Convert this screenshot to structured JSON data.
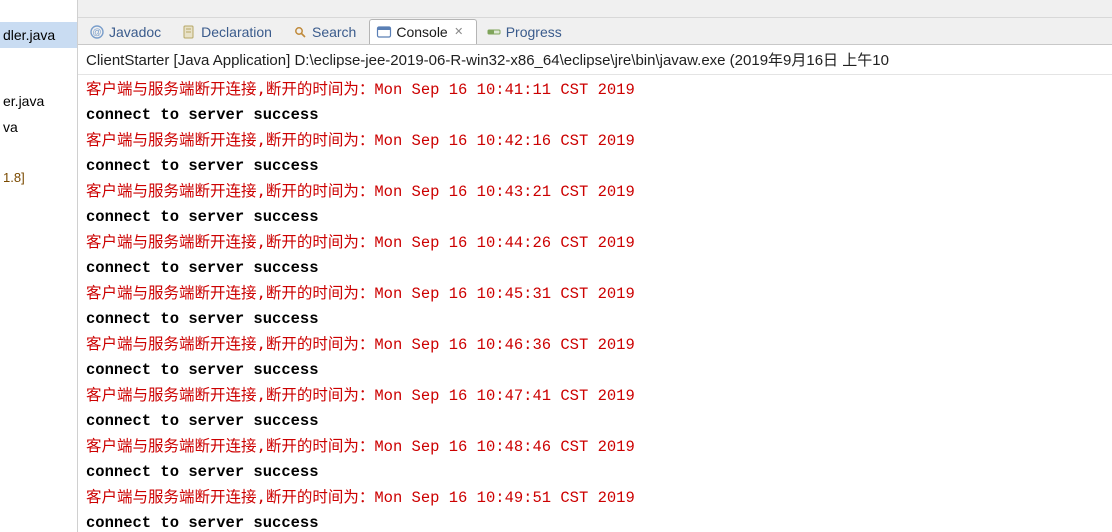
{
  "left_panel": {
    "files": [
      {
        "label": "dler.java",
        "selected": true
      },
      {
        "label": ""
      },
      {
        "label": "er.java"
      },
      {
        "label": "va"
      },
      {
        "label": ""
      },
      {
        "label": "1.8]"
      }
    ]
  },
  "tabs": [
    {
      "id": "javadoc",
      "label": "Javadoc",
      "icon": "at-icon",
      "active": false
    },
    {
      "id": "declaration",
      "label": "Declaration",
      "icon": "file-icon",
      "active": false
    },
    {
      "id": "search",
      "label": "Search",
      "icon": "search-icon",
      "active": false
    },
    {
      "id": "console",
      "label": "Console",
      "icon": "console-icon",
      "active": true
    },
    {
      "id": "progress",
      "label": "Progress",
      "icon": "progress-icon",
      "active": false
    }
  ],
  "close_x": "✕",
  "console": {
    "header": "ClientStarter [Java Application] D:\\eclipse-jee-2019-06-R-win32-x86_64\\eclipse\\jre\\bin\\javaw.exe (2019年9月16日 上午10",
    "err_prefix": "客户端与服务端断开连接,断开的时间为：",
    "ok_line": "connect to server success",
    "entries": [
      "Mon Sep 16 10:41:11 CST 2019",
      "Mon Sep 16 10:42:16 CST 2019",
      "Mon Sep 16 10:43:21 CST 2019",
      "Mon Sep 16 10:44:26 CST 2019",
      "Mon Sep 16 10:45:31 CST 2019",
      "Mon Sep 16 10:46:36 CST 2019",
      "Mon Sep 16 10:47:41 CST 2019",
      "Mon Sep 16 10:48:46 CST 2019",
      "Mon Sep 16 10:49:51 CST 2019"
    ]
  }
}
